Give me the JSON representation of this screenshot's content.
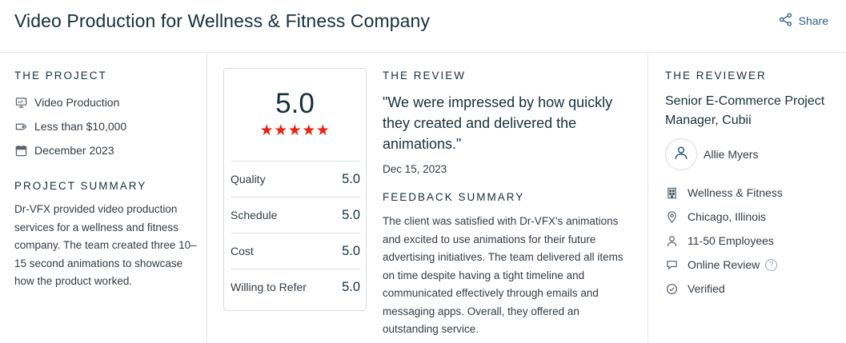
{
  "header": {
    "title": "Video Production for Wellness & Fitness Company",
    "share_label": "Share"
  },
  "project": {
    "section_label": "THE PROJECT",
    "meta": [
      {
        "icon": "monitor-icon",
        "text": "Video Production"
      },
      {
        "icon": "price-tag-icon",
        "text": "Less than $10,000"
      },
      {
        "icon": "calendar-icon",
        "text": "December 2023"
      }
    ],
    "summary_label": "PROJECT SUMMARY",
    "summary_text": "Dr-VFX provided video production services for a wellness and fitness company. The team created three 10–15 second animations to showcase how the product worked."
  },
  "scores": {
    "overall": "5.0",
    "stars": "★★★★★",
    "star_rating": 5,
    "rows": [
      {
        "label": "Quality",
        "value": "5.0"
      },
      {
        "label": "Schedule",
        "value": "5.0"
      },
      {
        "label": "Cost",
        "value": "5.0"
      },
      {
        "label": "Willing to Refer",
        "value": "5.0"
      }
    ]
  },
  "review": {
    "section_label": "THE REVIEW",
    "quote": "\"We were impressed by how quickly they created and delivered the animations.\"",
    "date": "Dec 15, 2023",
    "feedback_label": "FEEDBACK SUMMARY",
    "feedback_text": "The client was satisfied with Dr-VFX's animations and excited to use animations for their future advertising initiatives. The team delivered all items on time despite having a tight timeline and communicated effectively through emails and messaging apps. Overall, they offered an outstanding service."
  },
  "reviewer": {
    "section_label": "THE REVIEWER",
    "title": "Senior E-Commerce Project Manager, Cubii",
    "name": "Allie Myers",
    "details": [
      {
        "icon": "building-icon",
        "text": "Wellness & Fitness"
      },
      {
        "icon": "location-pin-icon",
        "text": "Chicago, Illinois"
      },
      {
        "icon": "person-icon",
        "text": "11-50 Employees"
      },
      {
        "icon": "chat-bubble-icon",
        "text": "Online Review"
      },
      {
        "icon": "check-circle-icon",
        "text": "Verified"
      }
    ],
    "help_glyph": "?"
  },
  "colors": {
    "star": "#e62415",
    "link": "#2c5f8a",
    "heading": "#17313b",
    "border": "#d7dde2"
  }
}
